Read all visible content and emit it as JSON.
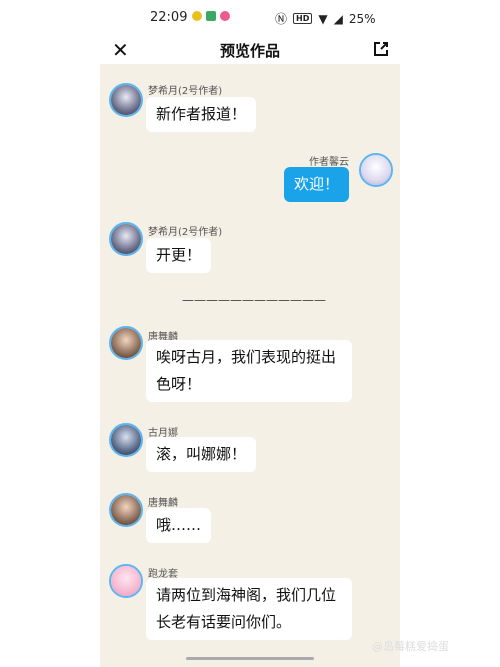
{
  "status": {
    "time": "22:09",
    "battery": "25%",
    "hd": "HD"
  },
  "header": {
    "title": "预览作品"
  },
  "messages": [
    {
      "name": "梦希月(2号作者)",
      "text": "新作者报道！"
    },
    {
      "name": "作者馨云",
      "text": "欢迎！"
    },
    {
      "name": "梦希月(2号作者)",
      "text": "开更！"
    },
    {
      "name": "唐舞麟",
      "text": "唉呀古月，我们表现的挺出色呀！"
    },
    {
      "name": "古月娜",
      "text": "滚，叫娜娜！"
    },
    {
      "name": "唐舞麟",
      "text": "哦……"
    },
    {
      "name": "跑龙套",
      "text": "请两位到海神阁，我们几位长老有话要问你们。"
    }
  ],
  "divider": "————————————",
  "watermark": "@岛莓糕爱捣蛋",
  "colors": {
    "accent": "#1aa3e8",
    "background": "#f5f0e6",
    "avatar_ring": "#5bb6f0"
  }
}
